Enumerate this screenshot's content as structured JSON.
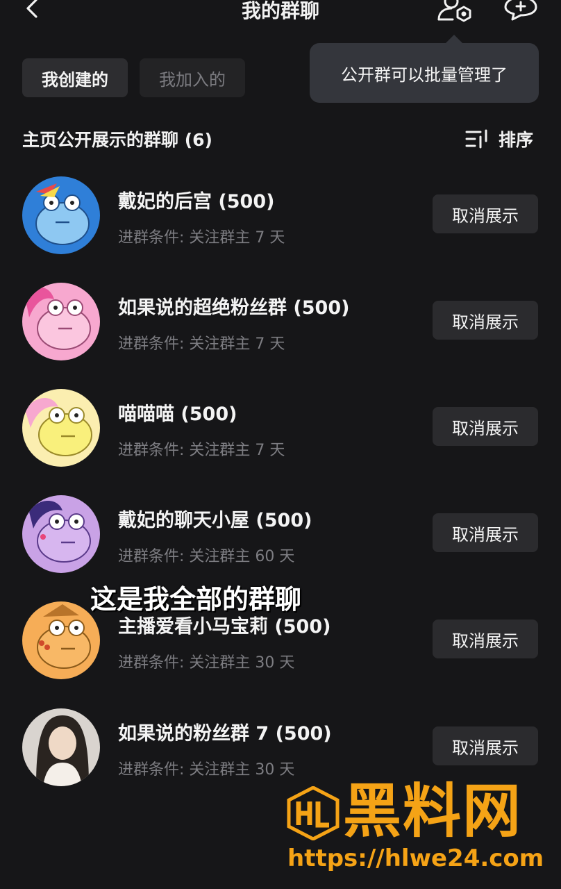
{
  "header": {
    "title": "我的群聊"
  },
  "tabs": [
    {
      "label": "我创建的",
      "active": true
    },
    {
      "label": "我加入的",
      "active": false
    }
  ],
  "tooltip": {
    "text": "公开群可以批量管理了"
  },
  "section": {
    "title": "主页公开展示的群聊 (6)",
    "sort_label": "排序"
  },
  "groups": [
    {
      "name": "戴妃的后宫 (500)",
      "condition": "进群条件: 关注群主 7 天",
      "button": "取消展示",
      "avatar_color": "#2f7fd8"
    },
    {
      "name": "如果说的超绝粉丝群 (500)",
      "condition": "进群条件: 关注群主 7 天",
      "button": "取消展示",
      "avatar_color": "#f7a8cf"
    },
    {
      "name": "喵喵喵 (500)",
      "condition": "进群条件: 关注群主 7 天",
      "button": "取消展示",
      "avatar_color": "#fbeeb0"
    },
    {
      "name": "戴妃的聊天小屋 (500)",
      "condition": "进群条件: 关注群主 60 天",
      "button": "取消展示",
      "avatar_color": "#c9a2e6"
    },
    {
      "name": "主播爱看小马宝莉 (500)",
      "condition": "进群条件: 关注群主 30 天",
      "button": "取消展示",
      "avatar_color": "#f6ad57"
    },
    {
      "name": "如果说的粉丝群 7 (500)",
      "condition": "进群条件: 关注群主 30 天",
      "button": "取消展示",
      "avatar_color": "#d9d4cf"
    }
  ],
  "caption": "这是我全部的群聊",
  "watermark": {
    "title": "黑料网",
    "url": "https://hlwe24.com",
    "color": "#f5a316"
  },
  "colors": {
    "background": "#161618",
    "button_bg": "#2b2b2e",
    "tooltip_bg": "#34363c"
  }
}
